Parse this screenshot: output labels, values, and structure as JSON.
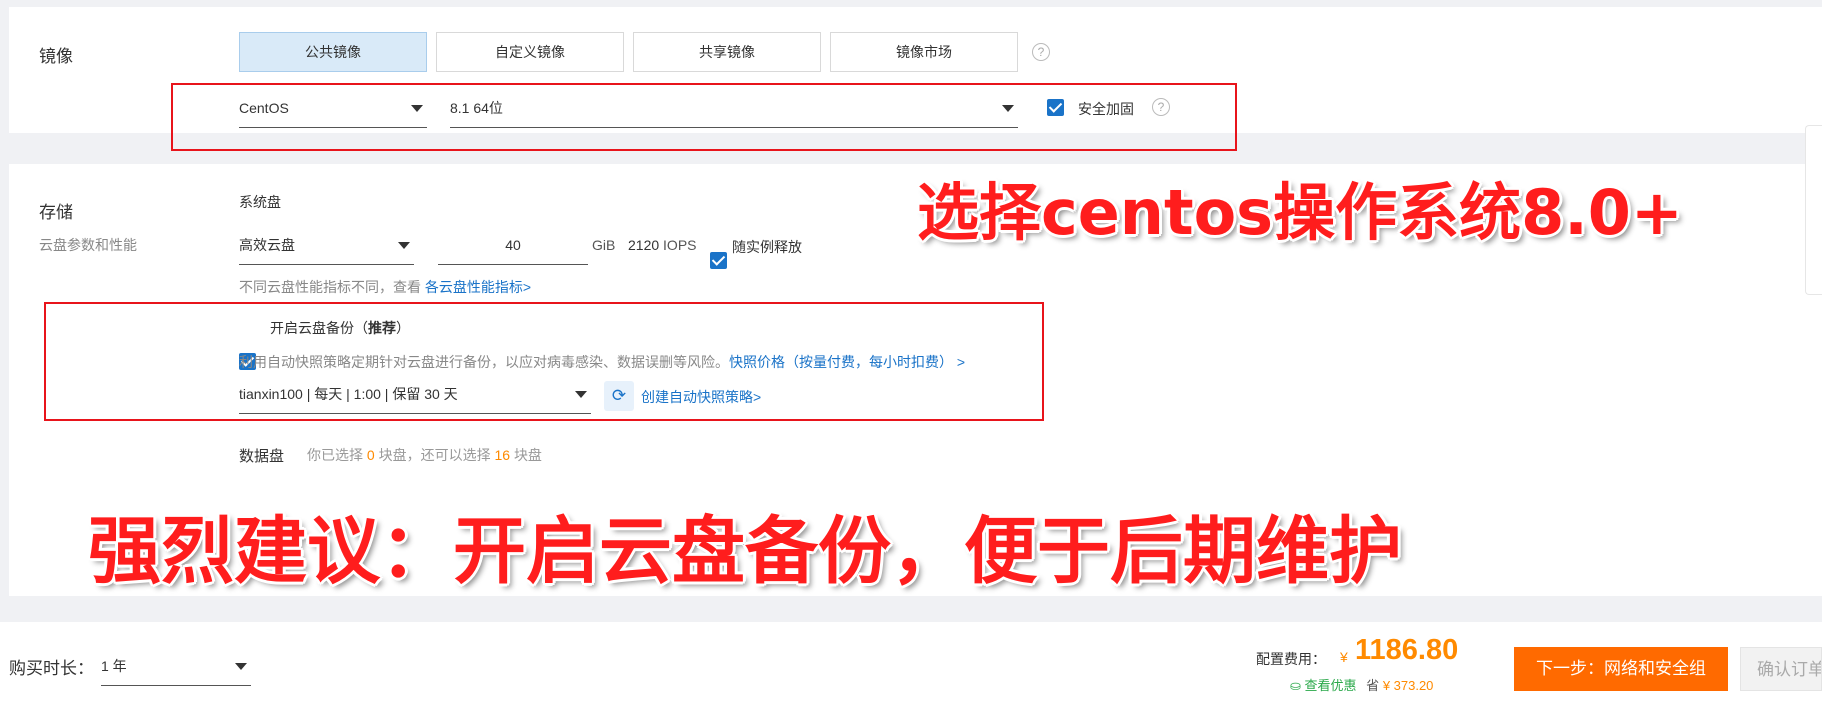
{
  "image_section": {
    "title": "镜像",
    "tabs": [
      {
        "label": "公共镜像",
        "active": true
      },
      {
        "label": "自定义镜像",
        "active": false
      },
      {
        "label": "共享镜像",
        "active": false
      },
      {
        "label": "镜像市场",
        "active": false
      }
    ],
    "os_select": "CentOS",
    "version_select": "8.1 64位",
    "security_label": "安全加固",
    "help_glyph": "?"
  },
  "storage_section": {
    "title": "存储",
    "subtitle": "云盘参数和性能",
    "system_disk_label": "系统盘",
    "disk_type": "高效云盘",
    "disk_size": "40",
    "disk_unit": "GiB",
    "iops_value": "2120",
    "iops_unit": "IOPS",
    "release_label": "随实例释放",
    "perf_note": "不同云盘性能指标不同，查看",
    "perf_link": "各云盘性能指标>",
    "backup_label": "开启云盘备份（",
    "backup_recommend": "推荐",
    "backup_close": "）",
    "backup_desc": "利用自动快照策略定期针对云盘进行备份，以应对病毒感染、数据误删等风险。",
    "backup_price_link": "快照价格（按量付费，每小时扣费） >",
    "snapshot_policy": "tianxin100 | 每天 | 1:00 | 保留 30 天",
    "create_policy_link": "创建自动快照策略>",
    "data_disk_label": "数据盘",
    "data_disk_note_prefix": "你已选择",
    "data_disk_selected": "0",
    "data_disk_note_mid": "块盘，还可以选择",
    "data_disk_remaining": "16",
    "data_disk_note_suffix": "块盘"
  },
  "annotations": {
    "os_note": "选择centos操作系统8.0+",
    "backup_note": "强烈建议：开启云盘备份，便于后期维护"
  },
  "footer": {
    "duration_label": "购买时长：",
    "duration_value": "1 年",
    "fee_label": "配置费用：",
    "currency": "¥",
    "fee_value": "1186.80",
    "discount_link": "查看优惠",
    "save_label": "省",
    "save_value": "¥ 373.20",
    "next_button": "下一步：网络和安全组",
    "confirm_button": "确认订单"
  },
  "colors": {
    "accent": "#1a73c8",
    "orange": "#ff6a00",
    "annotation_red": "#ff1d1d",
    "box_red": "#e8141b"
  }
}
